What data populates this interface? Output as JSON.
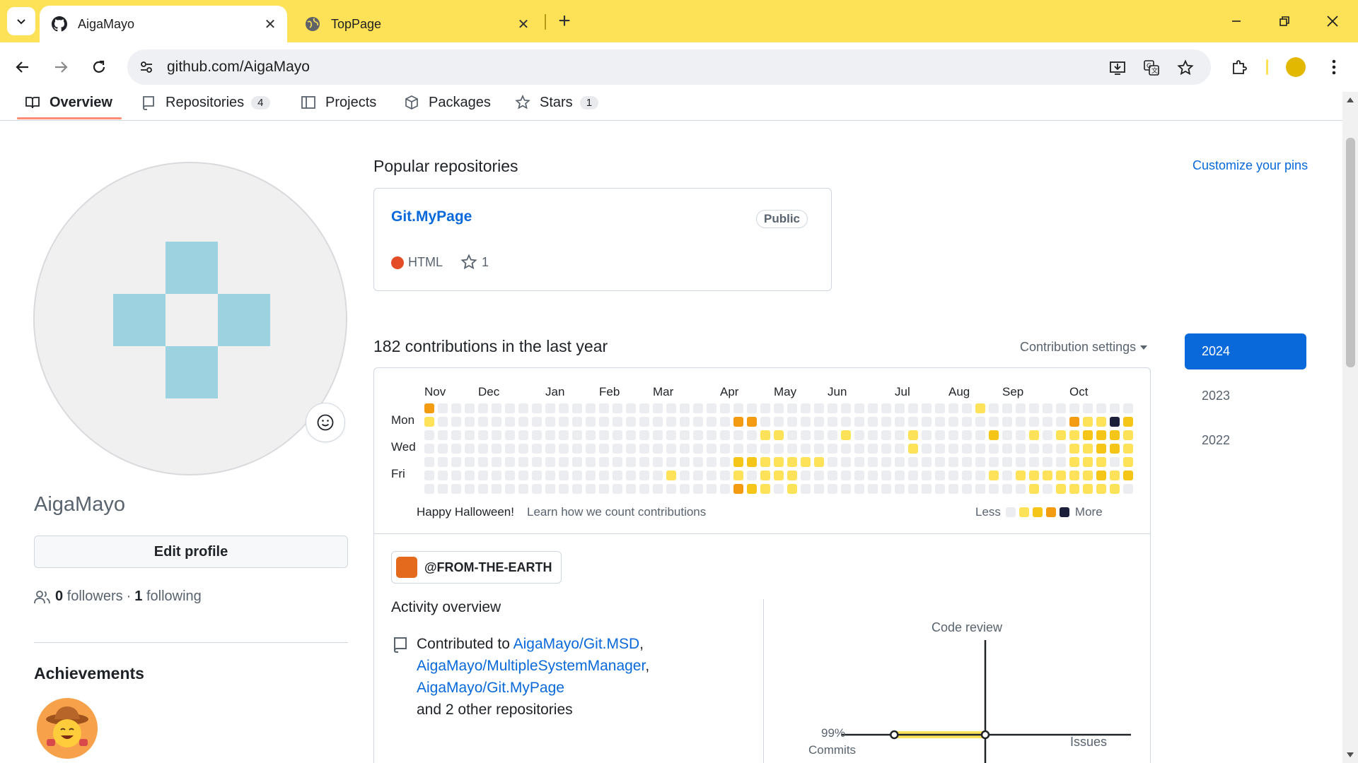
{
  "browser": {
    "tabs": [
      {
        "title": "AigaMayo",
        "favicon": "github-icon",
        "active": true
      },
      {
        "title": "TopPage",
        "favicon": "globe-icon",
        "active": false
      }
    ],
    "url": "github.com/AigaMayo",
    "accent_color": "#fde258"
  },
  "profile_tabs": [
    {
      "label": "Overview",
      "icon": "book-icon"
    },
    {
      "label": "Repositories",
      "icon": "repo-icon",
      "count": "4"
    },
    {
      "label": "Projects",
      "icon": "table-icon"
    },
    {
      "label": "Packages",
      "icon": "package-icon"
    },
    {
      "label": "Stars",
      "icon": "star-icon",
      "count": "1"
    }
  ],
  "profile": {
    "username": "AigaMayo",
    "edit_profile_label": "Edit profile",
    "followers_count": "0",
    "followers_label": "followers",
    "separator": "·",
    "following_count": "1",
    "following_label": "following",
    "achievements_title": "Achievements",
    "avatar_color": "#9dd3e0"
  },
  "popular": {
    "title": "Popular repositories",
    "customize_label": "Customize your pins",
    "repos": [
      {
        "name": "Git.MyPage",
        "visibility": "Public",
        "language": "HTML",
        "language_color": "#e34c26",
        "stars": "1"
      }
    ]
  },
  "contributions": {
    "title": "182 contributions in the last year",
    "settings_label": "Contribution settings",
    "months": [
      "Nov",
      "Dec",
      "Jan",
      "Feb",
      "Mar",
      "Apr",
      "May",
      "Jun",
      "Jul",
      "Aug",
      "Sep",
      "Oct"
    ],
    "days": [
      "Mon",
      "Wed",
      "Fri"
    ],
    "footer_note": "Happy Halloween!",
    "learn_link": "Learn how we count contributions",
    "legend_less": "Less",
    "legend_more": "More",
    "level_colors": [
      "#ebedf0",
      "#fde25a",
      "#f5c518",
      "#f39c12",
      "#1b1f3a"
    ],
    "grid": [
      "0000000000000000000000000000000000000000000000000000",
      "3000000000000000000000000330000000000000000000000334",
      "1000000000000000000000000000000000000000000000000103",
      "0000000000000000000000000000000000000000000000000000",
      "0000000000000000000000000000000000000000000000000000",
      "0000000000000000000000000000000000000000000000000000",
      "0000000000000000000000000000000000000000000000000000"
    ],
    "cells": [
      [
        1,
        0,
        3
      ],
      [
        1,
        1,
        1
      ],
      [
        24,
        1,
        3
      ],
      [
        24,
        4,
        2
      ],
      [
        24,
        5,
        1
      ],
      [
        24,
        6,
        3
      ],
      [
        25,
        1,
        3
      ],
      [
        25,
        4,
        2
      ],
      [
        25,
        6,
        2
      ],
      [
        26,
        2,
        1
      ],
      [
        26,
        4,
        1
      ],
      [
        26,
        5,
        1
      ],
      [
        26,
        6,
        1
      ],
      [
        27,
        2,
        1
      ],
      [
        27,
        4,
        1
      ],
      [
        27,
        5,
        1
      ],
      [
        28,
        4,
        1
      ],
      [
        28,
        5,
        1
      ],
      [
        28,
        6,
        1
      ],
      [
        29,
        4,
        1
      ],
      [
        30,
        4,
        1
      ],
      [
        19,
        5,
        1
      ],
      [
        32,
        2,
        1
      ],
      [
        37,
        2,
        1
      ],
      [
        37,
        3,
        1
      ],
      [
        42,
        0,
        1
      ],
      [
        43,
        2,
        2
      ],
      [
        43,
        5,
        1
      ],
      [
        45,
        5,
        1
      ],
      [
        46,
        2,
        1
      ],
      [
        46,
        5,
        1
      ],
      [
        46,
        6,
        1
      ],
      [
        47,
        5,
        1
      ],
      [
        47,
        7,
        1
      ],
      [
        48,
        2,
        1
      ],
      [
        48,
        5,
        1
      ],
      [
        48,
        6,
        1
      ],
      [
        49,
        1,
        3
      ],
      [
        49,
        2,
        1
      ],
      [
        49,
        3,
        1
      ],
      [
        49,
        4,
        1
      ],
      [
        49,
        5,
        1
      ],
      [
        49,
        6,
        1
      ],
      [
        50,
        1,
        1
      ],
      [
        50,
        2,
        2
      ],
      [
        50,
        3,
        1
      ],
      [
        50,
        4,
        1
      ],
      [
        50,
        5,
        1
      ],
      [
        50,
        6,
        1
      ],
      [
        51,
        1,
        1
      ],
      [
        51,
        2,
        2
      ],
      [
        51,
        3,
        2
      ],
      [
        51,
        4,
        1
      ],
      [
        51,
        5,
        2
      ],
      [
        51,
        6,
        1
      ],
      [
        52,
        1,
        4
      ],
      [
        52,
        2,
        2
      ],
      [
        52,
        3,
        2
      ],
      [
        52,
        5,
        1
      ],
      [
        52,
        6,
        1
      ],
      [
        53,
        1,
        2
      ],
      [
        53,
        2,
        1
      ],
      [
        53,
        3,
        1
      ],
      [
        53,
        4,
        1
      ],
      [
        53,
        5,
        2
      ]
    ]
  },
  "activity": {
    "org": "@FROM-THE-EARTH",
    "title": "Activity overview",
    "contributed_prefix": "Contributed to",
    "repos": [
      "AigaMayo/Git.MSD",
      "AigaMayo/MultipleSystemManager",
      "AigaMayo/Git.MyPage"
    ],
    "others": "and 2 other repositories",
    "code_review_label": "Code review",
    "commits_pct": "99%",
    "commits_label": "Commits",
    "issues_label": "Issues",
    "commits_fraction": 0.99
  },
  "years": [
    "2024",
    "2023",
    "2022"
  ]
}
